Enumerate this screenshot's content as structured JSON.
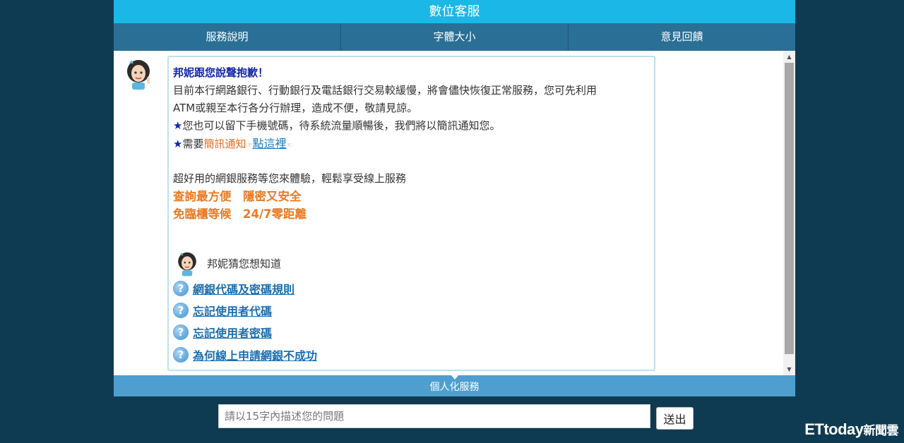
{
  "header": {
    "title": "數位客服"
  },
  "tabs": [
    {
      "label": "服務說明"
    },
    {
      "label": "字體大小"
    },
    {
      "label": "意見回饋"
    }
  ],
  "message": {
    "title": "邦妮跟您說聲抱歉！",
    "body_line1": "目前本行網路銀行、行動銀行及電話銀行交易較緩慢，將會儘快恢復正常服務，您可先利用",
    "body_line2": "ATM或親至本行各分行辦理，造成不便，敬請見諒。",
    "star_symbol": "★",
    "sms_line": "您也可以留下手機號碼，待系統流量順暢後，我們將以簡訊通知您。",
    "need_prefix": "需要",
    "sms_notify": "簡訊通知",
    "click_here": "點這裡",
    "promo_intro": "超好用的網銀服務等您來體驗，輕鬆享受線上服務",
    "promo_line1": "查詢最方便　隱密又安全",
    "promo_line2": "免臨櫃等候　24/7零距離"
  },
  "guess": {
    "label": "邦妮猜您想知道",
    "questions": [
      {
        "text": "網銀代碼及密碼規則"
      },
      {
        "text": "忘記使用者代碼"
      },
      {
        "text": "忘記使用者密碼"
      },
      {
        "text": "為何線上申請網銀不成功"
      }
    ]
  },
  "personal_service": {
    "label": "個人化服務"
  },
  "input": {
    "placeholder": "請以15字內描述您的問題"
  },
  "send_button": {
    "label": "送出"
  },
  "watermark": {
    "brand": "ETtoday",
    "suffix": "新聞雲"
  },
  "icons": [
    "avatar-icon",
    "question-icon",
    "hand-pointer-icon",
    "scroll-up-arrow-icon",
    "scroll-down-arrow-icon",
    "dropdown-triangle-icon"
  ],
  "colors": {
    "title_bar": "#1bb7e6",
    "tab_bar": "#2a6f95",
    "accent_orange": "#e86b1f",
    "link_blue": "#1a7cc1",
    "background": "#0f3b52"
  }
}
